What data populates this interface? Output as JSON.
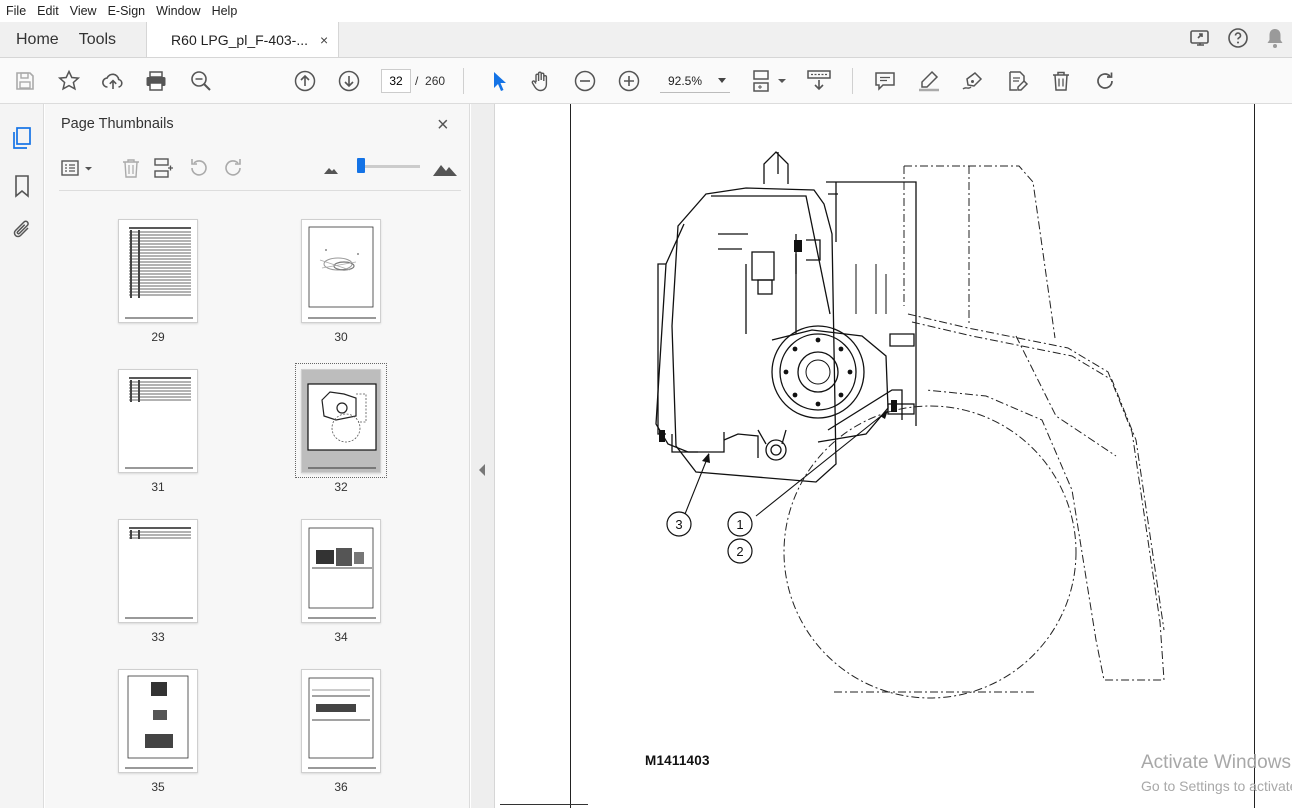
{
  "menu": [
    "File",
    "Edit",
    "View",
    "E-Sign",
    "Window",
    "Help"
  ],
  "tabs": {
    "home": "Home",
    "tools": "Tools",
    "document": "R60 LPG_pl_F-403-...",
    "close": "×"
  },
  "toolbar": {
    "page_current": "32",
    "page_separator": "/",
    "page_total": "260",
    "zoom": "92.5%"
  },
  "panel": {
    "title": "Page Thumbnails",
    "close": "×",
    "thumbnails": [
      {
        "label": "29",
        "kind": "table",
        "selected": false
      },
      {
        "label": "30",
        "kind": "exploded",
        "selected": false
      },
      {
        "label": "31",
        "kind": "table-short",
        "selected": false
      },
      {
        "label": "32",
        "kind": "drawing",
        "selected": true
      },
      {
        "label": "33",
        "kind": "table-tiny",
        "selected": false
      },
      {
        "label": "34",
        "kind": "mechanical",
        "selected": false
      },
      {
        "label": "35",
        "kind": "detail",
        "selected": false
      },
      {
        "label": "36",
        "kind": "schematic",
        "selected": false
      }
    ]
  },
  "document": {
    "callouts": [
      "1",
      "2",
      "3"
    ],
    "drawing_id": "M1411403"
  },
  "watermark": {
    "line1": "Activate Windows",
    "line2": "Go to Settings to activate Windows."
  },
  "colors": {
    "accent": "#1473e6",
    "ink": "#111111"
  }
}
